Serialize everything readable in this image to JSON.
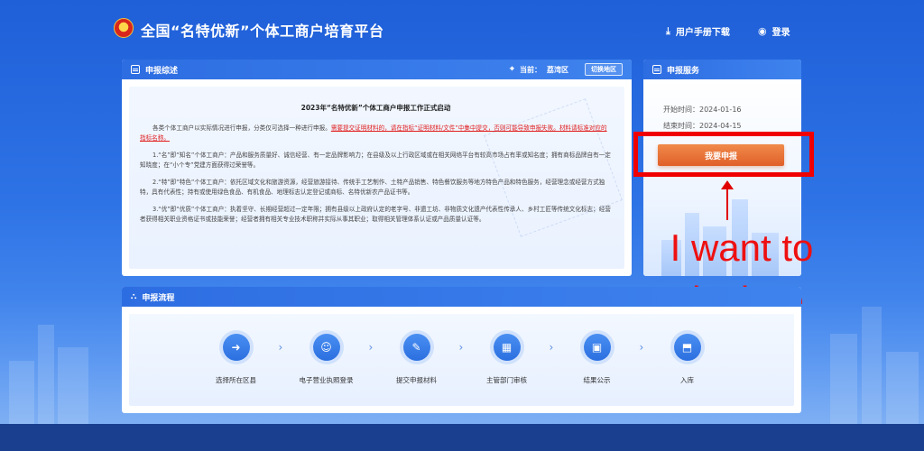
{
  "header": {
    "title": "全国“名特优新”个体工商户培育平台",
    "manual_download": "用户手册下载",
    "login": "登录"
  },
  "summary": {
    "heading": "申报综述",
    "current_label": "当前：",
    "current_region": "荔湾区",
    "switch_label": "切换地区",
    "doc_title": "2023年“名特优新”个体工商户申报工作正式启动",
    "p0_a": "各类个体工商户以实际情况进行申报，分类仅可选择一种进行申报。",
    "p0_b": "需要提交证明材料的，请在指标“证明材料/文件”中集中提交，否则可能导致申报失败。材料请标准对应的指标名称。",
    "p1": "1.“名”即“知名”个体工商户：产品和服务质量好、诚信经营、有一定品牌影响力；在县级及以上行政区域或在相关网络平台有较高市场占有率或知名度；拥有商标品牌自有一定知晓度；在“小个专”党建方面获得过荣誉等。",
    "p2": "2.“特”即“特色”个体工商户：依托区域文化和旅游资源，经营旅游接待、传统手工艺制作、土特产品销售、特色餐饮服务等地方特色产品和特色服务，经营理念或经营方式独特，具有代表性；持有或使用绿色食品、有机食品、地理标志认定登记或商标、名特优新农产品证书等。",
    "p3": "3.“优”即“优质”个体工商户：执着坚守、长期经营超过一定年限；拥有县级以上政府认定的老字号、非遗工坊、非物质文化遗产代表性传承人、乡村工匠等传统文化标志；经营者获得相关职业资格证书或技能荣誉；经营者拥有相关专业技术职称并实际从事其职业；取得相关管理体系认证或产品质量认证等。"
  },
  "service": {
    "heading": "申报服务",
    "start_label": "开始时间：",
    "start_date": "2024-01-16",
    "end_label": "结束时间：",
    "end_date": "2024-04-15",
    "declare_button": "我要申报"
  },
  "annotation": {
    "text": "I want to declare",
    "color": "#ee1010"
  },
  "flow": {
    "heading": "申报流程",
    "steps": [
      {
        "label": "选择所在区县",
        "icon": "login-arrow-icon"
      },
      {
        "label": "电子营业执照登录",
        "icon": "user-icon"
      },
      {
        "label": "提交申报材料",
        "icon": "document-edit-icon"
      },
      {
        "label": "主管部门审核",
        "icon": "review-icon"
      },
      {
        "label": "结果公示",
        "icon": "briefcase-icon"
      },
      {
        "label": "入库",
        "icon": "storage-icon"
      }
    ]
  },
  "colors": {
    "brand_blue": "#2d6de2",
    "declare_orange": "#e0602a",
    "highlight_red": "#f00000"
  }
}
